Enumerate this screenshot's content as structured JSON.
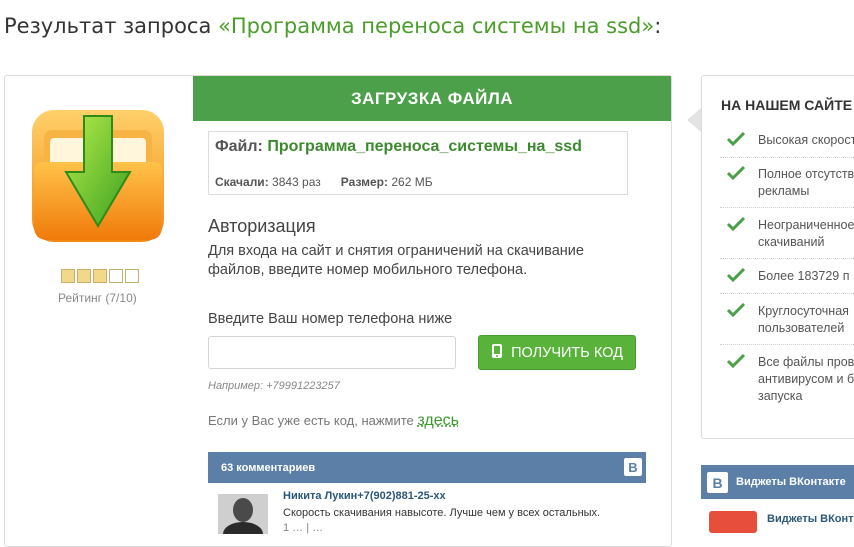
{
  "header": {
    "prefix": "Результат запроса ",
    "query": "«Программа переноса системы на ssd»",
    "suffix": ":"
  },
  "rating": {
    "value": 7,
    "max": 10,
    "stars_filled": 3,
    "stars_total": 5,
    "label": "Рейтинг (7/10)"
  },
  "download": {
    "header": "ЗАГРУЗКА ФАЙЛА",
    "file_label": "Файл:",
    "file_name": "Программа_переноса_системы_на_ssd",
    "downloads_label": "Скачали:",
    "downloads_value": "3843 раз",
    "size_label": "Размер:",
    "size_value": "262 МБ"
  },
  "auth": {
    "title": "Авторизация",
    "description": "Для входа на сайт и снятия ограничений на скачивание файлов, введите номер мобильного телефона.",
    "phone_label": "Введите Ваш номер телефона ниже",
    "phone_value": "",
    "button_label": "ПОЛУЧИТЬ КОД",
    "example": "Например: +79991223257",
    "has_code_text": "Если у Вас уже есть код, нажмите ",
    "has_code_link": "здесь"
  },
  "comments": {
    "count_label": "63 комментариев",
    "vk_logo": "B",
    "first": {
      "author": "Никита  Лукин+7(902)881-25-xx",
      "text": "Скорость скачивания навысоте. Лучше чем у всех остальных.",
      "sub": "1 …        | …"
    }
  },
  "sidebar": {
    "title": "НА НАШЕМ САЙТЕ",
    "features": [
      {
        "lines": [
          "Высокая скорость"
        ]
      },
      {
        "lines": [
          "Полное отсутствие",
          "рекламы"
        ]
      },
      {
        "lines": [
          "Неограниченное",
          "скачиваний"
        ]
      },
      {
        "lines": [
          "Более 183729 п"
        ]
      },
      {
        "lines": [
          "Круглосуточная",
          "пользователей"
        ]
      },
      {
        "lines": [
          "Все файлы пров",
          "антивирусом и б",
          "запуска"
        ]
      }
    ],
    "vk_widget_title": "Виджеты ВКонтакте",
    "vk_widget_item": "Виджеты ВКонт",
    "vk_logo": "B"
  },
  "colors": {
    "accent_green": "#4ca04a",
    "link_green": "#3c8a2e",
    "vk_blue": "#5b7fa6"
  }
}
